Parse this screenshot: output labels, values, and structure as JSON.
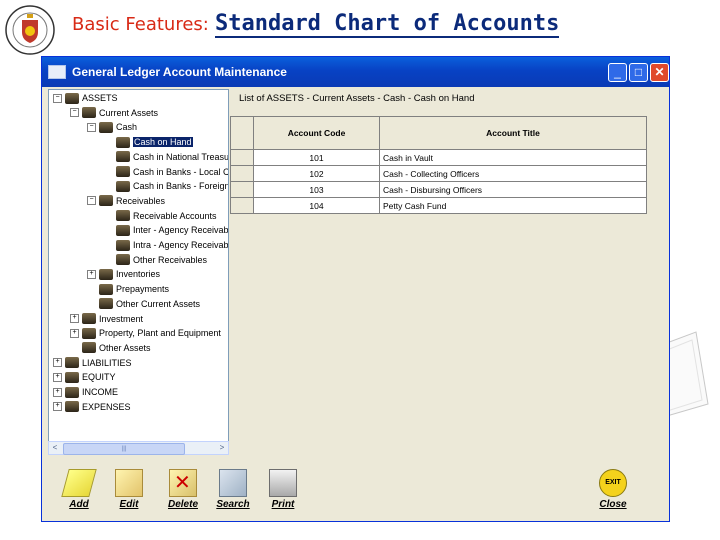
{
  "slide": {
    "title_prefix": "Basic Features:",
    "title_main": "Standard Chart of Accounts"
  },
  "window": {
    "title": "General Ledger Account Maintenance",
    "buttons": {
      "minimize": "_",
      "maximize": "□",
      "close": "✕"
    }
  },
  "tree": {
    "expanded_sign": "−",
    "collapsed_sign": "+",
    "items": [
      {
        "label": "ASSETS",
        "level": 0,
        "toggle": "expanded",
        "selected": false
      },
      {
        "label": "Current Assets",
        "level": 1,
        "toggle": "expanded",
        "selected": false
      },
      {
        "label": "Cash",
        "level": 2,
        "toggle": "expanded",
        "selected": false
      },
      {
        "label": "Cash on Hand",
        "level": 3,
        "toggle": "none",
        "selected": true
      },
      {
        "label": "Cash in National Treasury",
        "level": 3,
        "toggle": "none",
        "selected": false
      },
      {
        "label": "Cash in Banks - Local Currency",
        "level": 3,
        "toggle": "none",
        "selected": false
      },
      {
        "label": "Cash in Banks - Foreign Currency",
        "level": 3,
        "toggle": "none",
        "selected": false
      },
      {
        "label": "Receivables",
        "level": 2,
        "toggle": "expanded",
        "selected": false
      },
      {
        "label": "Receivable Accounts",
        "level": 3,
        "toggle": "none",
        "selected": false
      },
      {
        "label": "Inter - Agency Receivables",
        "level": 3,
        "toggle": "none",
        "selected": false
      },
      {
        "label": "Intra - Agency Receivables",
        "level": 3,
        "toggle": "none",
        "selected": false
      },
      {
        "label": "Other Receivables",
        "level": 3,
        "toggle": "none",
        "selected": false
      },
      {
        "label": "Inventories",
        "level": 2,
        "toggle": "collapsed",
        "selected": false
      },
      {
        "label": "Prepayments",
        "level": 2,
        "toggle": "none",
        "selected": false
      },
      {
        "label": "Other Current Assets",
        "level": 2,
        "toggle": "none",
        "selected": false
      },
      {
        "label": "Investment",
        "level": 1,
        "toggle": "collapsed",
        "selected": false
      },
      {
        "label": "Property, Plant and Equipment",
        "level": 1,
        "toggle": "collapsed",
        "selected": false
      },
      {
        "label": "Other Assets",
        "level": 1,
        "toggle": "none",
        "selected": false
      },
      {
        "label": "LIABILITIES",
        "level": 0,
        "toggle": "collapsed",
        "selected": false
      },
      {
        "label": "EQUITY",
        "level": 0,
        "toggle": "collapsed",
        "selected": false
      },
      {
        "label": "INCOME",
        "level": 0,
        "toggle": "collapsed",
        "selected": false
      },
      {
        "label": "EXPENSES",
        "level": 0,
        "toggle": "collapsed",
        "selected": false
      }
    ],
    "scroll_left": "<",
    "scroll_right": ">",
    "scroll_grip": "|||"
  },
  "list": {
    "title": "List of ASSETS - Current Assets - Cash - Cash on Hand",
    "headers": [
      "Account Code",
      "Account Title"
    ],
    "rows": [
      {
        "code": "101",
        "title": "Cash in Vault"
      },
      {
        "code": "102",
        "title": "Cash - Collecting Officers"
      },
      {
        "code": "103",
        "title": "Cash - Disbursing Officers"
      },
      {
        "code": "104",
        "title": "Petty Cash Fund"
      }
    ]
  },
  "toolbar": {
    "add": "Add",
    "edit": "Edit",
    "delete": "Delete",
    "search": "Search",
    "print": "Print",
    "close": "Close",
    "exit_icon_text": "EXIT"
  },
  "icons": [
    "logo-seal-icon",
    "window-app-icon",
    "folder-icon",
    "add-icon",
    "edit-icon",
    "delete-icon",
    "search-icon",
    "print-icon",
    "exit-icon"
  ],
  "colors": {
    "title_red": "#d82a16",
    "title_blue": "#0b2a7a",
    "xp_blue": "#0842c4",
    "selection": "#0a246a"
  }
}
